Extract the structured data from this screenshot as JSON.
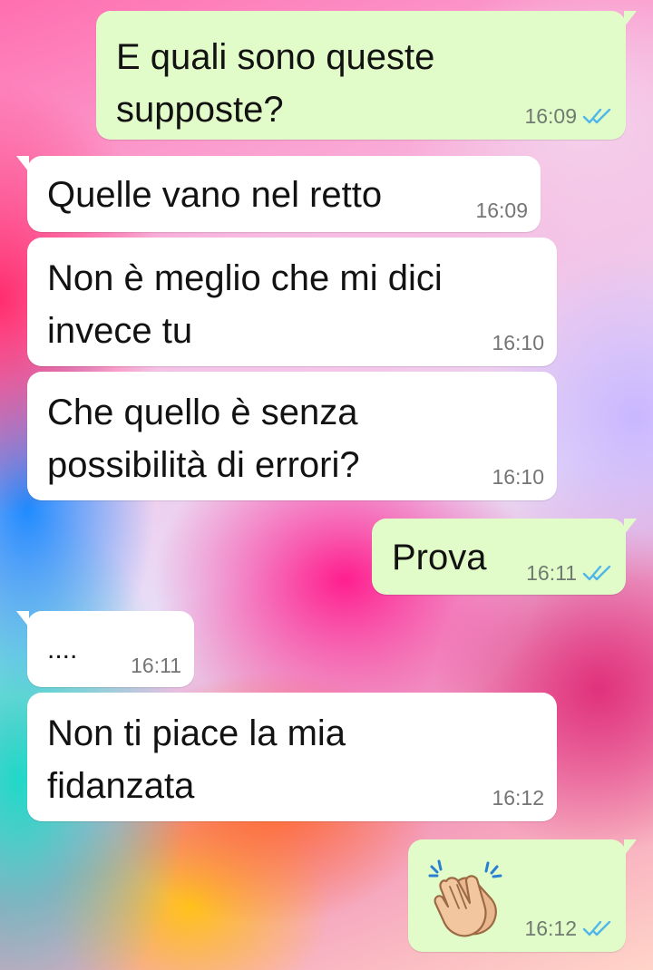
{
  "messages": [
    {
      "dir": "out",
      "text": "E quali sono queste supposte?",
      "time": "16:09",
      "status": "read-ticks-icon"
    },
    {
      "dir": "in",
      "text": "Quelle vano nel retto",
      "time": "16:09"
    },
    {
      "dir": "in",
      "text": "Non è meglio che mi dici invece tu",
      "time": "16:10"
    },
    {
      "dir": "in",
      "text": "Che quello è senza possibilità di errori?",
      "time": "16:10"
    },
    {
      "dir": "out",
      "text": "Prova",
      "time": "16:11",
      "status": "read-ticks-icon"
    },
    {
      "dir": "in",
      "text": "....",
      "time": "16:11"
    },
    {
      "dir": "in",
      "text": "Non ti piace la mia fidanzata",
      "time": "16:12"
    },
    {
      "dir": "out",
      "emoji": "clapping-hands-icon",
      "time": "16:12",
      "status": "read-ticks-icon"
    }
  ],
  "colors": {
    "outgoing_bubble": "#e2fcc9",
    "incoming_bubble": "#ffffff",
    "read_ticks": "#4fb6ec",
    "timestamp": "#757575"
  }
}
